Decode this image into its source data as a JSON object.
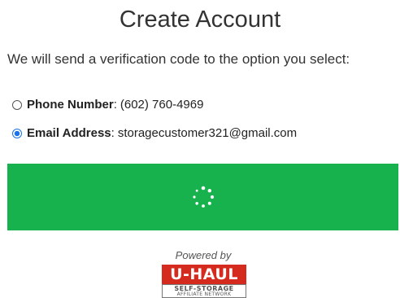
{
  "page": {
    "title": "Create Account",
    "subtitle": "We will send a verification code to the option you select:"
  },
  "options": [
    {
      "label": "Phone Number",
      "separator": ":",
      "value": "(602) 760-4969",
      "selected": false
    },
    {
      "label": "Email Address",
      "separator": ":",
      "value": "storagecustomer321@gmail.com",
      "selected": true
    }
  ],
  "submit": {
    "state": "loading",
    "icon": "spinner-icon",
    "color": "#17b24e"
  },
  "footer": {
    "powered_by": "Powered by",
    "logo_top": "U-HAUL",
    "logo_line1": "SELF-STORAGE",
    "logo_line2": "AFFILIATE NETWORK",
    "logo_color": "#d52b1e"
  },
  "colors": {
    "accent": "#1a73e8",
    "button": "#17b24e",
    "text": "#333333"
  }
}
